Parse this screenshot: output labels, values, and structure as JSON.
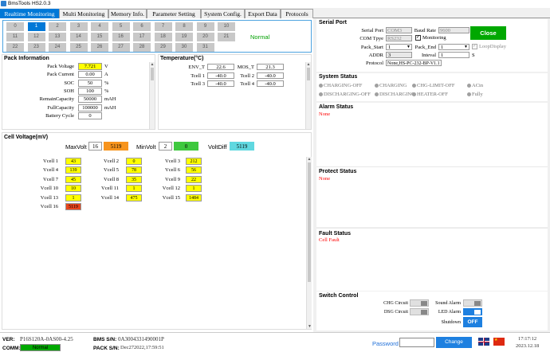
{
  "app": {
    "title": "BmsTools HS2.0.3"
  },
  "tabs": [
    "Realtime Monitoring",
    "Multi Monitoring",
    "Memory Info.",
    "Parameter Setting",
    "System Config.",
    "Export Data",
    "Protocols"
  ],
  "cell_selector": {
    "cells": [
      "0",
      "1",
      "2",
      "3",
      "4",
      "5",
      "6",
      "7",
      "8",
      "9",
      "10",
      "11",
      "12",
      "13",
      "14",
      "15",
      "16",
      "17",
      "18",
      "19",
      "20",
      "21",
      "22",
      "23",
      "24",
      "25",
      "26",
      "27",
      "28",
      "29",
      "30",
      "31"
    ],
    "selected": "1",
    "status": "Normal"
  },
  "pack": {
    "title": "Pack Information",
    "rows": [
      {
        "label": "Pack Voltage",
        "value": "7.721",
        "unit": "V"
      },
      {
        "label": "Pack Current",
        "value": "0.00",
        "unit": "A"
      },
      {
        "label": "SOC",
        "value": "50",
        "unit": "%"
      },
      {
        "label": "SOH",
        "value": "100",
        "unit": "%"
      },
      {
        "label": "RemainCapacity",
        "value": "50000",
        "unit": "mAH"
      },
      {
        "label": "FullCapacity",
        "value": "100000",
        "unit": "mAH"
      },
      {
        "label": "Battery Cycle",
        "value": "0",
        "unit": ""
      }
    ]
  },
  "temperature": {
    "title": "Temperature(°C)",
    "env_label": "ENV_T",
    "env_value": "22.6",
    "mos_label": "MOS_T",
    "mos_value": "21.3",
    "cells": [
      {
        "label": "Tcell 1",
        "value": "-40.0"
      },
      {
        "label": "Tcell 2",
        "value": "-40.0"
      },
      {
        "label": "Tcell 3",
        "value": "-40.0"
      },
      {
        "label": "Tcell 4",
        "value": "-40.0"
      }
    ]
  },
  "cellvoltage": {
    "title": "Cell Voltage(mV)",
    "maxvolt_label": "MaxVolt",
    "maxvolt_idx": "16",
    "maxvolt_val": "5119",
    "minvolt_label": "MinVolt",
    "minvolt_idx": "2",
    "minvolt_val": "0",
    "voltdiff_label": "VoltDiff",
    "voltdiff_val": "5119",
    "cells": [
      {
        "label": "Vcell 1",
        "value": "43"
      },
      {
        "label": "Vcell 2",
        "value": "0"
      },
      {
        "label": "Vcell 3",
        "value": "212"
      },
      {
        "label": "Vcell 4",
        "value": "139"
      },
      {
        "label": "Vcell 5",
        "value": "78"
      },
      {
        "label": "Vcell 6",
        "value": "56"
      },
      {
        "label": "Vcell 7",
        "value": "45"
      },
      {
        "label": "Vcell 8",
        "value": "35"
      },
      {
        "label": "Vcell 9",
        "value": "22"
      },
      {
        "label": "Vcell 10",
        "value": "10"
      },
      {
        "label": "Vcell 11",
        "value": "1"
      },
      {
        "label": "Vcell 12",
        "value": "1"
      },
      {
        "label": "Vcell 13",
        "value": "1"
      },
      {
        "label": "Vcell 14",
        "value": "475"
      },
      {
        "label": "Vcell 15",
        "value": "1484"
      },
      {
        "label": "Vcell 16",
        "value": "5119"
      }
    ]
  },
  "serial": {
    "title": "Serial Port",
    "serial_port_label": "Serial Port",
    "serial_port_value": "COM3",
    "baud_label": "Baud Rate",
    "baud_value": "9600",
    "com_label": "COM Tpye",
    "com_value": "RS232",
    "monitoring_label": "Monitoring",
    "close_label": "Close",
    "pack_start_label": "Pack_Start",
    "pack_start_value": "1",
    "pack_end_label": "Pack_End",
    "pack_end_value": "1",
    "loop_label": "LoopDisplay",
    "addr_label": "ADDR",
    "addr_value": "3",
    "interval_label": "Inteval",
    "interval_value": "1",
    "interval_unit": "S",
    "protocol_label": "Protocol",
    "protocol_value": "None,HS-PC-232-BP-V1.1"
  },
  "system_status": {
    "title": "System Status",
    "items": [
      "CHARGING-OFF",
      "CHARGING",
      "CHG-LIMIT-OFF",
      "ACin",
      "DISCHARGING-OFF",
      "DISCHARGING",
      "HEATER-OFF",
      "Fully"
    ]
  },
  "alarm_status": {
    "title": "Alarm Status",
    "value": "None"
  },
  "protect_status": {
    "title": "Protect Status",
    "value": "None"
  },
  "fault_status": {
    "title": "Fault Status",
    "value": "Cell Fault"
  },
  "switch_control": {
    "title": "Switch Control",
    "chg_label": "CHG Circuit",
    "dsg_label": "DSG Circuit",
    "sound_label": "Sound Alarm",
    "led_label": "LED Alarm",
    "shutdown_label": "Shutdown",
    "shutdown_value": "OFF"
  },
  "statusbar": {
    "ver_label": "VER:",
    "ver_value": "P16S120A-0AS00-4.25",
    "comm_label": "COMM:",
    "comm_value": "Normal",
    "bms_sn_label": "BMS S/N:",
    "bms_sn_value": "0A3004331490001P",
    "pack_sn_label": "PACK S/N:",
    "pack_sn_value": "Dec272022,17:59:51",
    "password_label": "Password",
    "change_label": "Change",
    "time": "17:17:12",
    "date": "2023.12.18"
  },
  "colors": {
    "accent": "#0078d7",
    "green": "#00a800",
    "normal_green": "#00a000",
    "yellow": "#ffff00",
    "orange": "#f7941d",
    "red": "#e8451b",
    "cyan": "#60d8e0",
    "alert_red": "#ff0000"
  }
}
